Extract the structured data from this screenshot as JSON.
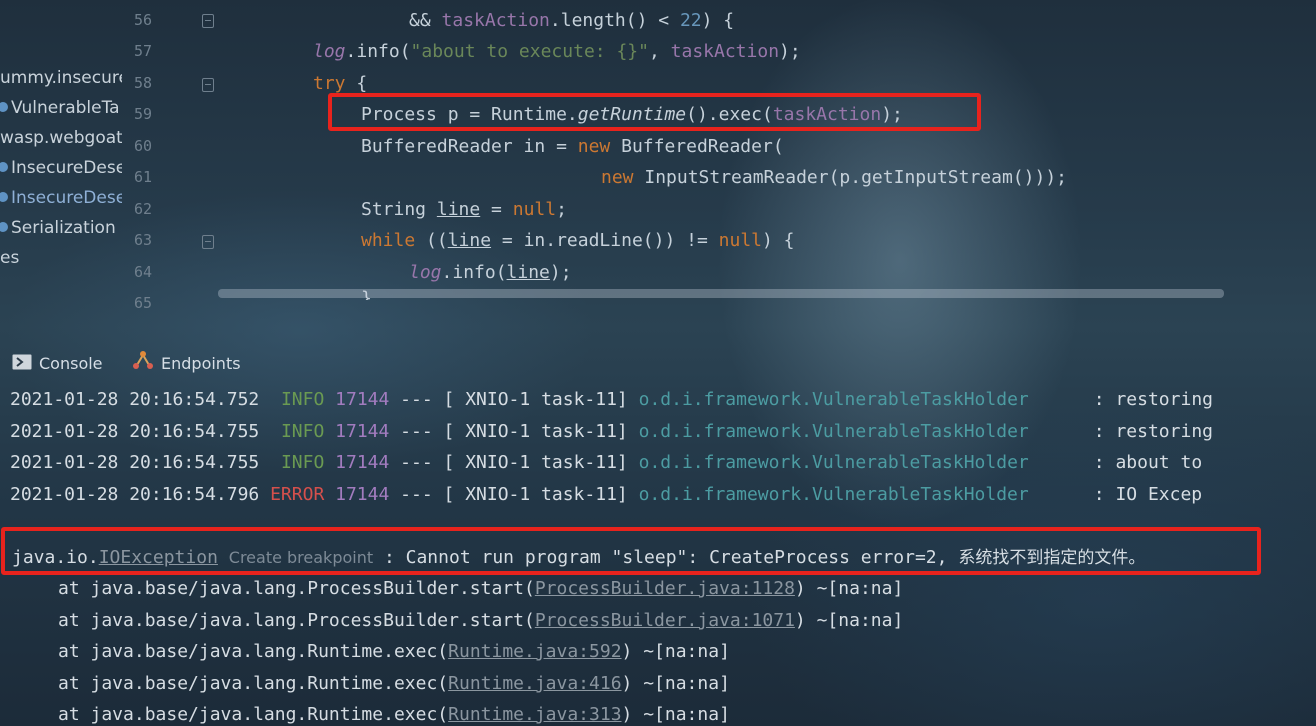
{
  "project_tree": {
    "items": [
      {
        "label": "ummy.insecure",
        "style": "package",
        "dot": false
      },
      {
        "label": "VulnerableTa",
        "style": "class",
        "dot": true
      },
      {
        "label": "wasp.webgoat",
        "style": "package",
        "dot": false
      },
      {
        "label": "InsecureDese",
        "style": "class",
        "dot": true
      },
      {
        "label": "InsecureDese",
        "style": "class-link",
        "dot": true
      },
      {
        "label": "Serialization",
        "style": "class",
        "dot": true
      },
      {
        "label": "es",
        "style": "package",
        "dot": false
      }
    ]
  },
  "editor": {
    "line_numbers": [
      "56",
      "57",
      "58",
      "59",
      "60",
      "61",
      "62",
      "63",
      "64",
      "65"
    ],
    "code": {
      "l56": {
        "a": "&& ",
        "b": "taskAction",
        "c": ".length() < ",
        "d": "22",
        "e": ") {"
      },
      "l57": {
        "a": "log",
        "b": ".info(",
        "c": "\"about to execute: {}\"",
        "d": ", ",
        "e": "taskAction",
        "f": ");"
      },
      "l58": {
        "a": "try",
        "b": " {"
      },
      "l59": {
        "a": "Process p = Runtime.",
        "b": "getRuntime",
        "c": "().exec(",
        "d": "taskAction",
        "e": ");"
      },
      "l60": {
        "a": "BufferedReader in = ",
        "b": "new",
        "c": " BufferedReader("
      },
      "l61": {
        "a": "new",
        "b": " InputStreamReader(p.getInputStream()));"
      },
      "l62": {
        "a": "String ",
        "b": "line",
        "c": " = ",
        "d": "null",
        "e": ";"
      },
      "l63": {
        "a": "while",
        "b": " ((",
        "c": "line",
        "d": " = in.readLine()) != ",
        "e": "null",
        "f": ") {"
      },
      "l64": {
        "a": "log",
        "b": ".info(",
        "c": "line",
        "d": ");"
      },
      "l65": {
        "a": "}"
      }
    }
  },
  "tool_window": {
    "tabs": [
      {
        "label": "Console",
        "icon": "console-icon"
      },
      {
        "label": "Endpoints",
        "icon": "endpoints-icon"
      }
    ]
  },
  "console": {
    "log_lines": [
      {
        "timestamp": "2021-01-28 20:16:54.752",
        "level": "INFO",
        "pid": "17144",
        "sep": "---",
        "thread": "[ XNIO-1 task-11]",
        "logger": "o.d.i.framework.VulnerableTaskHolder",
        "message": ": restoring"
      },
      {
        "timestamp": "2021-01-28 20:16:54.755",
        "level": "INFO",
        "pid": "17144",
        "sep": "---",
        "thread": "[ XNIO-1 task-11]",
        "logger": "o.d.i.framework.VulnerableTaskHolder",
        "message": ": restoring"
      },
      {
        "timestamp": "2021-01-28 20:16:54.755",
        "level": "INFO",
        "pid": "17144",
        "sep": "---",
        "thread": "[ XNIO-1 task-11]",
        "logger": "o.d.i.framework.VulnerableTaskHolder",
        "message": ": about to"
      },
      {
        "timestamp": "2021-01-28 20:16:54.796",
        "level": "ERROR",
        "pid": "17144",
        "sep": "---",
        "thread": "[ XNIO-1 task-11]",
        "logger": "o.d.i.framework.VulnerableTaskHolder",
        "message": ": IO Excep"
      }
    ],
    "exception": {
      "prefix": "java.io.",
      "class_link": "IOException",
      "hint": "Create breakpoint",
      "message": " : Cannot run program \"sleep\": CreateProcess error=2, ",
      "message_cjk": "系统找不到指定的文件。"
    },
    "stack": [
      {
        "at": "at java.base/java.lang.ProcessBuilder.start(",
        "link": "ProcessBuilder.java:1128",
        "tail": ") ~[na:na]"
      },
      {
        "at": "at java.base/java.lang.ProcessBuilder.start(",
        "link": "ProcessBuilder.java:1071",
        "tail": ") ~[na:na]"
      },
      {
        "at": "at java.base/java.lang.Runtime.exec(",
        "link": "Runtime.java:592",
        "tail": ") ~[na:na]"
      },
      {
        "at": "at java.base/java.lang.Runtime.exec(",
        "link": "Runtime.java:416",
        "tail": ") ~[na:na]"
      },
      {
        "at": "at java.base/java.lang.Runtime.exec(",
        "link": "Runtime.java:313",
        "tail": ") ~[na:na]"
      }
    ]
  },
  "colors": {
    "keyword": "#cc7832",
    "field": "#9876aa",
    "string": "#6a8759",
    "number": "#6897bb",
    "info_level": "#6a9a52",
    "error_level": "#d5504c",
    "annotation_box": "#e8231d"
  }
}
